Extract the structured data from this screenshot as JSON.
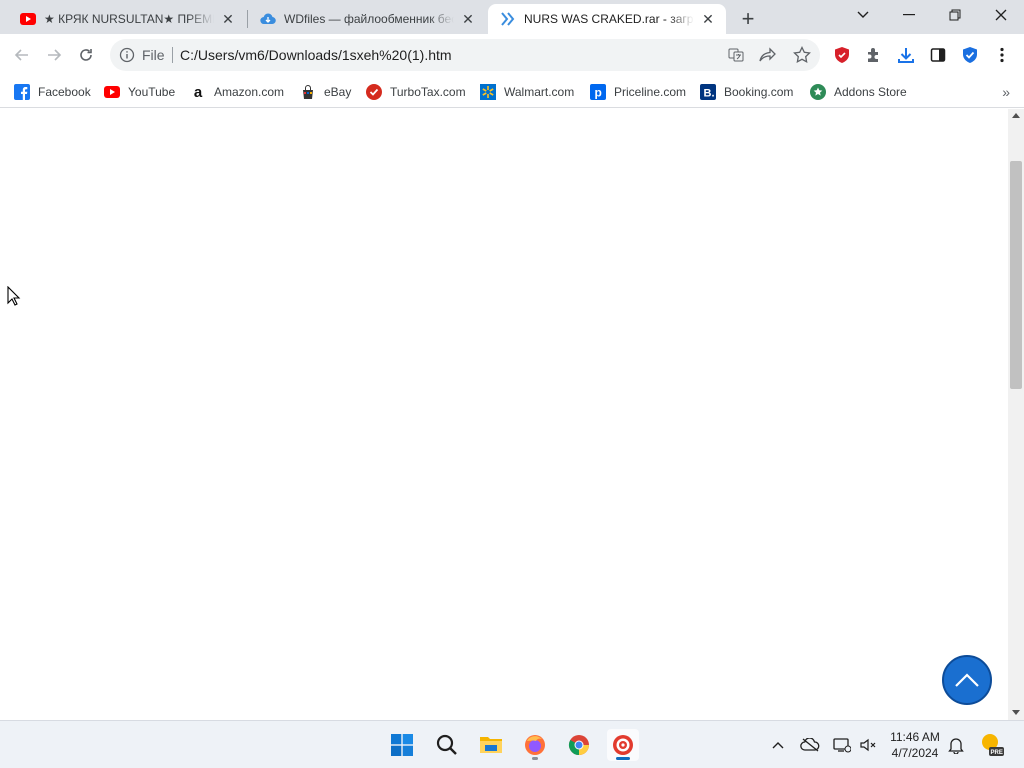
{
  "browser": {
    "tabs": [
      {
        "title": "★ КРЯК NURSULTAN★ ПРЕМИУМ",
        "favicon": "youtube-icon",
        "active": false
      },
      {
        "title": "WDfiles — файлообменник бесплатно",
        "favicon": "cloud-icon",
        "active": false
      },
      {
        "title": "NURS WAS CRAKED.rar - загрузка",
        "favicon": "chevrons-icon",
        "active": true
      }
    ],
    "new_tab_label": "+",
    "omnibox": {
      "scheme_label": "File",
      "url": "C:/Users/vm6/Downloads/1sxeh%20(1).htm"
    },
    "bookmarks": [
      {
        "label": "Facebook",
        "icon": "facebook-icon",
        "color": "#1877f2"
      },
      {
        "label": "YouTube",
        "icon": "youtube-icon",
        "color": "#ff0000"
      },
      {
        "label": "Amazon.com",
        "icon": "amazon-icon",
        "color": "#000000"
      },
      {
        "label": "eBay",
        "icon": "ebay-icon",
        "color": "#e53238"
      },
      {
        "label": "TurboTax.com",
        "icon": "turbotax-icon",
        "color": "#d52b1e"
      },
      {
        "label": "Walmart.com",
        "icon": "walmart-icon",
        "color": "#0071ce"
      },
      {
        "label": "Priceline.com",
        "icon": "priceline-icon",
        "color": "#0068ef"
      },
      {
        "label": "Booking.com",
        "icon": "booking-icon",
        "color": "#003580"
      },
      {
        "label": "Addons Store",
        "icon": "addons-icon",
        "color": "#2e8b57"
      }
    ]
  },
  "page": {
    "scroll_to_top_color": "#1a6fd0"
  },
  "taskbar": {
    "apps": [
      "start-icon",
      "search-icon",
      "file-explorer-icon",
      "firefox-icon",
      "chrome-icon",
      "app-icon"
    ],
    "clock": {
      "time": "11:46 AM",
      "date": "4/7/2024"
    },
    "weather_badge": "PRE"
  }
}
